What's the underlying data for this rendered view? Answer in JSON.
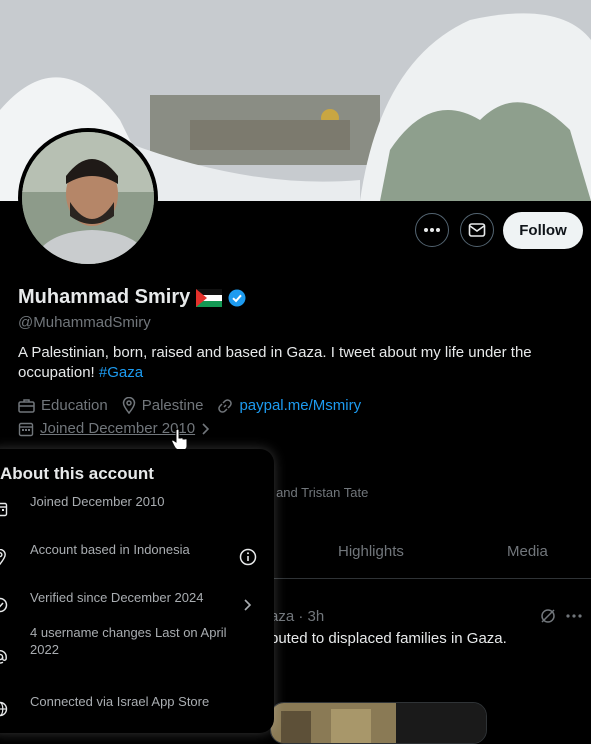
{
  "profile": {
    "name": "Muhammad Smiry",
    "handle": "@MuhammadSmiry",
    "bio_text": "A Palestinian, born, raised and based in Gaza. I tweet about my life under the occupation! ",
    "bio_hashtag": "#Gaza",
    "category": "Education",
    "location": "Palestine",
    "link": "paypal.me/Msmiry",
    "joined": "Joined December 2010",
    "followed_by_partial": "nt, and Tristan Tate"
  },
  "actions": {
    "follow_label": "Follow"
  },
  "tabs": {
    "highlights": "Highlights",
    "media": "Media"
  },
  "post": {
    "meta_partial": "aza · 3h",
    "text_partial": "buted to displaced families in Gaza."
  },
  "about_popup": {
    "title": "About this account",
    "items": [
      {
        "icon": "calendar-icon",
        "text": "Joined December 2010"
      },
      {
        "icon": "location-pin-icon",
        "text": "Account based in Indonesia"
      },
      {
        "icon": "verified-badge-icon",
        "text": "Verified since December 2024"
      },
      {
        "icon": "at-sign-icon",
        "text": "4 username changes Last on April 2022"
      },
      {
        "icon": "globe-icon",
        "text": "Connected via Israel App Store"
      }
    ]
  },
  "colors": {
    "accent": "#1d9bf0",
    "background": "#000000",
    "muted": "#71767b"
  }
}
